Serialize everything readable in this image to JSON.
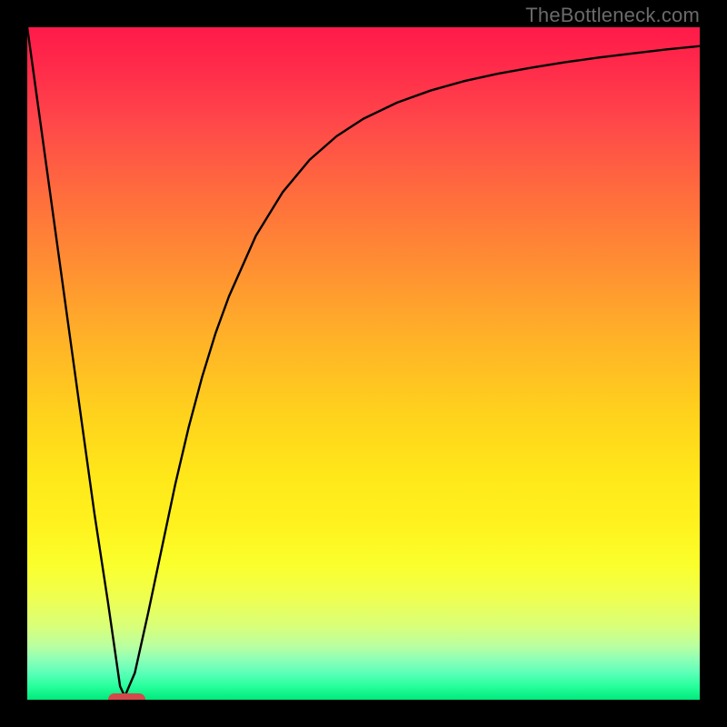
{
  "watermark": "TheBottleneck.com",
  "colors": {
    "frame": "#000000",
    "curve": "#000000",
    "marker": "#d24a4a"
  },
  "chart_data": {
    "type": "line",
    "title": "",
    "xlabel": "",
    "ylabel": "",
    "xlim": [
      0,
      1
    ],
    "ylim": [
      0,
      1
    ],
    "x": [
      0.0,
      0.02,
      0.04,
      0.06,
      0.08,
      0.1,
      0.12,
      0.138,
      0.145,
      0.16,
      0.18,
      0.2,
      0.22,
      0.24,
      0.26,
      0.28,
      0.3,
      0.34,
      0.38,
      0.42,
      0.46,
      0.5,
      0.55,
      0.6,
      0.65,
      0.7,
      0.75,
      0.8,
      0.85,
      0.9,
      0.95,
      1.0
    ],
    "y": [
      1.0,
      0.855,
      0.71,
      0.565,
      0.42,
      0.276,
      0.145,
      0.02,
      0.005,
      0.04,
      0.13,
      0.225,
      0.32,
      0.405,
      0.48,
      0.545,
      0.6,
      0.69,
      0.755,
      0.803,
      0.838,
      0.864,
      0.888,
      0.906,
      0.92,
      0.931,
      0.94,
      0.948,
      0.955,
      0.961,
      0.967,
      0.972
    ],
    "marker": {
      "x_center": 0.148,
      "width": 0.055,
      "y": 0.0
    }
  }
}
